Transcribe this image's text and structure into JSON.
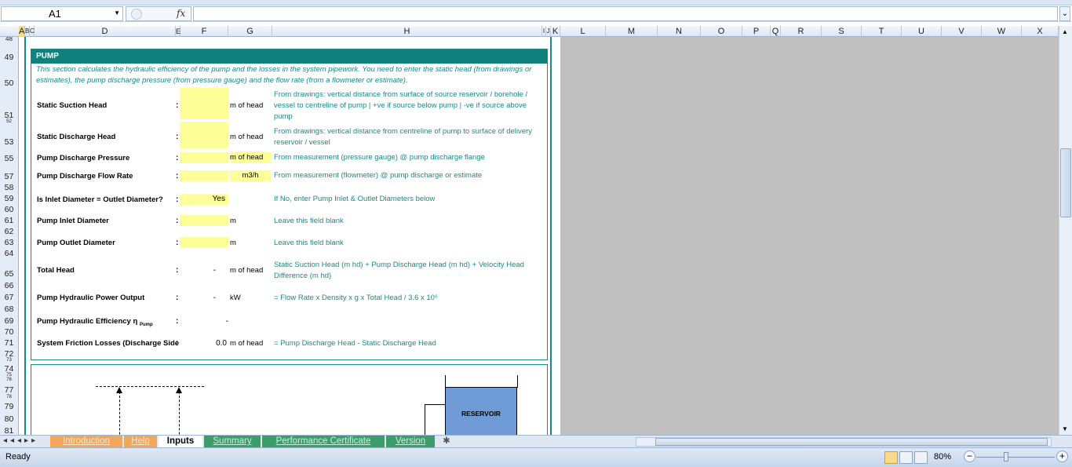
{
  "formula_bar": {
    "cell_ref": "A1",
    "fx_label": "fx",
    "formula": ""
  },
  "columns": [
    "A",
    "B",
    "C",
    "D",
    "E",
    "F",
    "G",
    "H",
    "I",
    "J",
    "K",
    "L",
    "M",
    "N",
    "O",
    "P",
    "Q",
    "R",
    "S",
    "T",
    "U",
    "V",
    "W",
    "X"
  ],
  "rows": [
    "48",
    "49",
    "50",
    "51",
    "52",
    "53",
    "55",
    "57",
    "58",
    "59",
    "60",
    "61",
    "62",
    "63",
    "64",
    "65",
    "66",
    "67",
    "68",
    "69",
    "70",
    "71",
    "72",
    "73",
    "74",
    "75",
    "76",
    "77",
    "78",
    "79",
    "80",
    "81"
  ],
  "pump": {
    "title": "PUMP",
    "intro": "This section calculates the hydraulic efficiency of the pump and the losses in the system pipework.  You need to enter the static head (from drawings or estimates), the pump discharge pressure (from pressure gauge) and the flow rate (from a flowmeter or estimate).",
    "colon": ":",
    "rows": [
      {
        "label": "Static Suction Head",
        "value": "",
        "unit": "m of head",
        "note": "From drawings: vertical distance from surface of source reservoir / borehole / vessel to centreline of pump  |  +ve if source below pump  |  -ve if source above pump"
      },
      {
        "label": "Static Discharge Head",
        "value": "",
        "unit": "m of head",
        "note": "From drawings: vertical distance from centreline of pump to surface of delivery reservoir / vessel"
      },
      {
        "label": "Pump Discharge Pressure",
        "value": "",
        "unit": "m of head",
        "note": "From measurement (pressure gauge) @ pump discharge flange"
      },
      {
        "label": "Pump Discharge Flow Rate",
        "value": "",
        "unit": "m3/h",
        "note": "From measurement (flowmeter) @ pump discharge or estimate"
      },
      {
        "label": "Is Inlet Diameter = Outlet Diameter?",
        "value": "Yes",
        "unit": "",
        "note": "If No, enter Pump Inlet & Outlet Diameters below"
      },
      {
        "label": "Pump Inlet Diameter",
        "value": "",
        "unit": "m",
        "note": "Leave this field blank"
      },
      {
        "label": "Pump Outlet Diameter",
        "value": "",
        "unit": "m",
        "note": "Leave this field blank"
      },
      {
        "label": "Total Head",
        "value": "-",
        "unit": "m of head",
        "note": "Static Suction Head (m hd) + Pump Discharge Head (m hd) + Velocity Head Difference (m hd)"
      },
      {
        "label": "Pump Hydraulic Power Output",
        "value": "-",
        "unit": "kW",
        "note": "= Flow Rate x Density x g x Total Head / 3.6 x 10⁶"
      },
      {
        "label": "Pump Hydraulic Efficiency η",
        "label_sub": "Pump",
        "value": "-",
        "unit": "",
        "note": ""
      },
      {
        "label": "System Friction Losses (Discharge Side",
        "value": "0.0",
        "unit": "m of head",
        "note": "= Pump Discharge Head - Static Discharge Head"
      }
    ]
  },
  "diagram": {
    "reservoir_label": "RESERVOIR"
  },
  "tabs": [
    {
      "label": "Introduction",
      "style": "or"
    },
    {
      "label": "Help",
      "style": "or"
    },
    {
      "label": "Inputs",
      "style": "act"
    },
    {
      "label": "Summary",
      "style": "gr"
    },
    {
      "label": "Performance Certificate",
      "style": "gr"
    },
    {
      "label": "Version",
      "style": "gr"
    }
  ],
  "status": {
    "ready": "Ready",
    "zoom": "80%",
    "zoom_minus": "−",
    "zoom_plus": "+"
  },
  "colors": {
    "teal": "#12807c",
    "input_yellow": "#ffff99",
    "reservoir": "#6f9bd6"
  }
}
